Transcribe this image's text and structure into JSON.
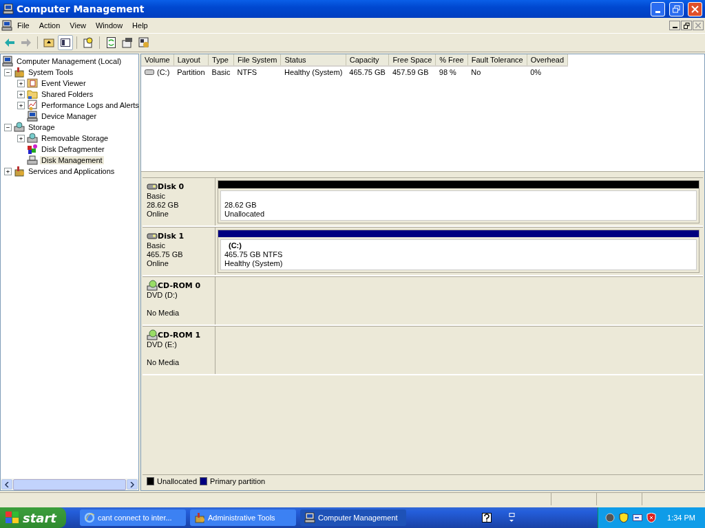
{
  "window": {
    "title": "Computer Management"
  },
  "menu": [
    "File",
    "Action",
    "View",
    "Window",
    "Help"
  ],
  "tree": [
    {
      "label": "Computer Management (Local)",
      "selected": false,
      "children": [
        {
          "label": "System Tools",
          "toggle": "−",
          "selected": false,
          "children": [
            {
              "label": "Event Viewer",
              "toggle": "+",
              "selected": false
            },
            {
              "label": "Shared Folders",
              "toggle": "+",
              "selected": false
            },
            {
              "label": "Performance Logs and Alerts",
              "toggle": "+",
              "selected": false
            },
            {
              "label": "Device Manager",
              "selected": false
            }
          ]
        },
        {
          "label": "Storage",
          "toggle": "−",
          "selected": false,
          "children": [
            {
              "label": "Removable Storage",
              "toggle": "+",
              "selected": false
            },
            {
              "label": "Disk Defragmenter",
              "selected": false
            },
            {
              "label": "Disk Management",
              "selected": true
            }
          ]
        },
        {
          "label": "Services and Applications",
          "toggle": "+",
          "selected": false
        }
      ]
    }
  ],
  "table": {
    "columns": [
      "Volume",
      "Layout",
      "Type",
      "File System",
      "Status",
      "Capacity",
      "Free Space",
      "% Free",
      "Fault Tolerance",
      "Overhead"
    ],
    "rows": [
      [
        "(C:)",
        "Partition",
        "Basic",
        "NTFS",
        "Healthy (System)",
        "465.75 GB",
        "457.59 GB",
        "98 %",
        "No",
        "0%"
      ]
    ]
  },
  "disks": [
    {
      "kind": "disk",
      "name": "Disk 0",
      "lines": [
        "Basic",
        "28.62 GB",
        "Online"
      ],
      "partitions": [
        {
          "color": "#000000",
          "lines": [
            "28.62 GB",
            "Unallocated"
          ]
        }
      ]
    },
    {
      "kind": "disk",
      "name": "Disk 1",
      "lines": [
        "Basic",
        "465.75 GB",
        "Online"
      ],
      "partitions": [
        {
          "color": "#000080",
          "name": "(C:)",
          "lines": [
            "465.75 GB NTFS",
            "Healthy (System)"
          ]
        }
      ]
    },
    {
      "kind": "cdrom",
      "name": "CD-ROM 0",
      "lines": [
        "DVD (D:)",
        "No Media"
      ]
    },
    {
      "kind": "cdrom",
      "name": "CD-ROM 1",
      "lines": [
        "DVD (E:)",
        "No Media"
      ]
    }
  ],
  "legend": [
    {
      "label": "Unallocated",
      "color": "#000000"
    },
    {
      "label": "Primary partition",
      "color": "#000080"
    }
  ],
  "taskbar": {
    "start": "start",
    "tasks": [
      {
        "label": "cant connect to inter...",
        "selected": false
      },
      {
        "label": "Administrative Tools",
        "selected": false
      },
      {
        "label": "Computer Management",
        "selected": true
      }
    ],
    "clock": "1:34 PM"
  }
}
